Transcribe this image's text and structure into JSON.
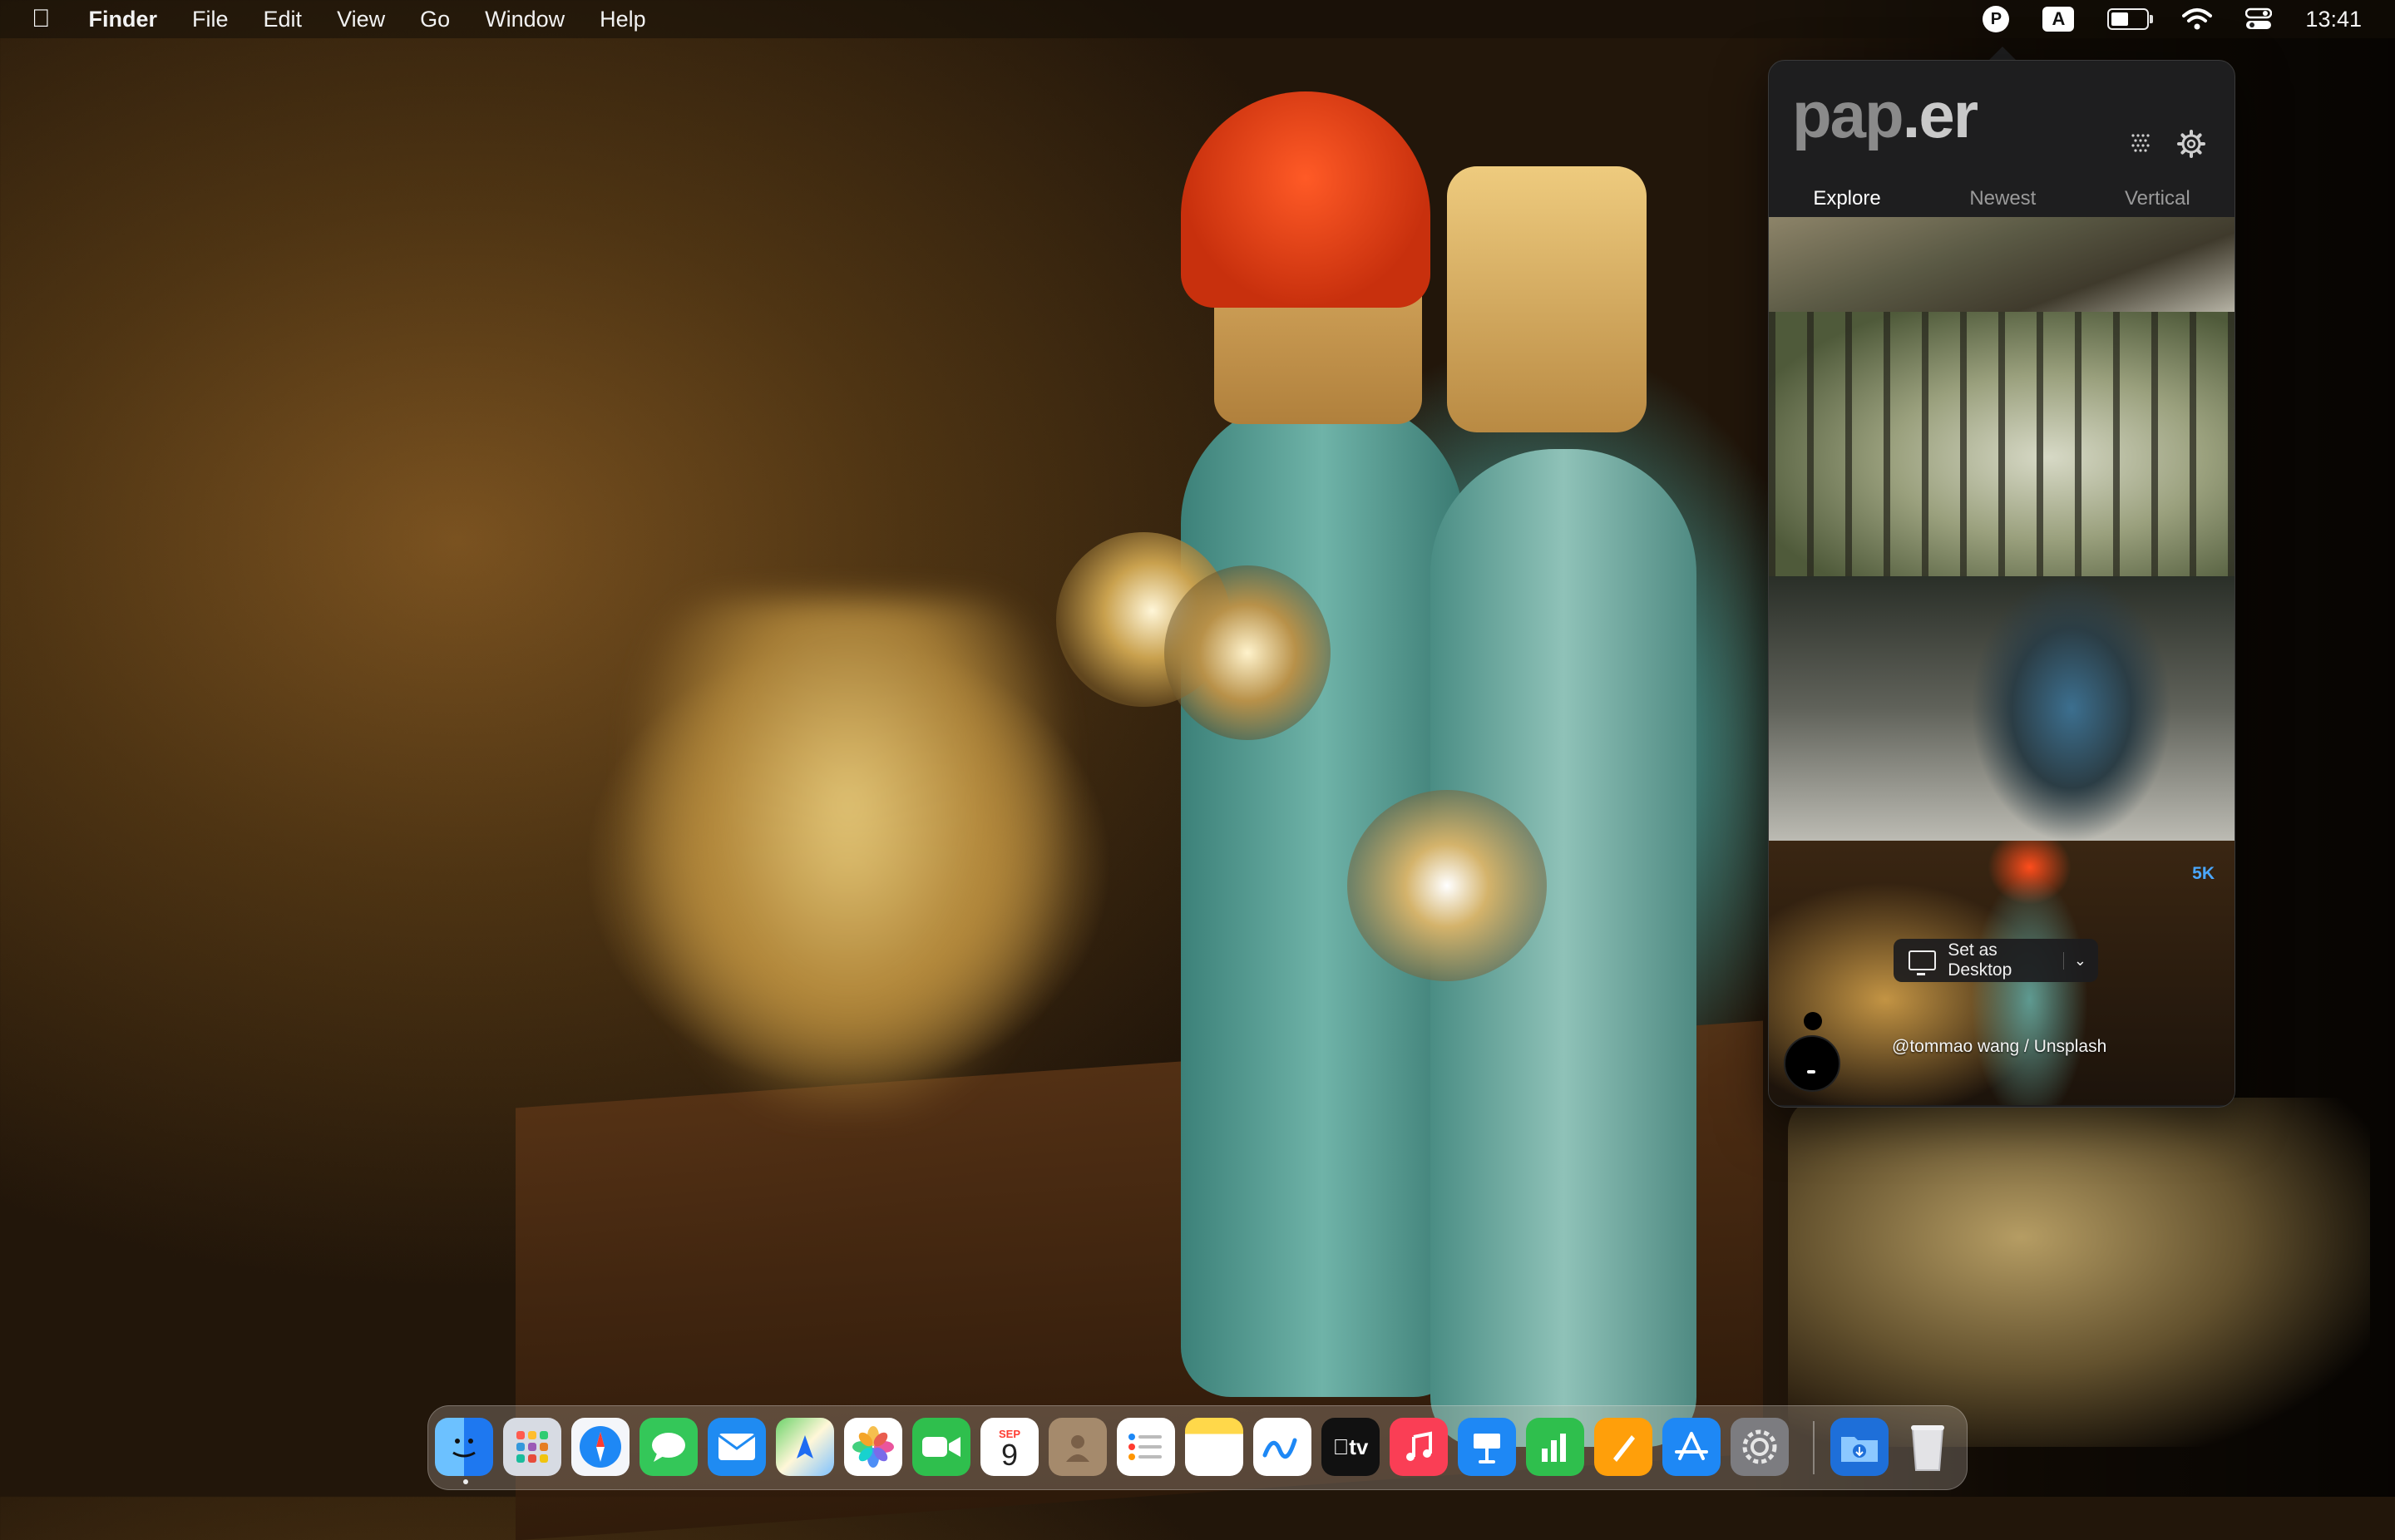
{
  "menubar": {
    "app_name": "Finder",
    "items": [
      "File",
      "Edit",
      "View",
      "Go",
      "Window",
      "Help"
    ],
    "paper_status": "P",
    "input_source": "A",
    "battery_level": 0.55,
    "clock": "13:41"
  },
  "popover": {
    "logo_part1": "pap",
    "logo_part2": ".er",
    "tabs": [
      "Explore",
      "Newest",
      "Vertical"
    ],
    "active_tab": "Explore",
    "featured": {
      "resolution": "5K",
      "set_desktop_label": "Set as Desktop",
      "credit": "@tommao wang / Unsplash"
    }
  },
  "dock": {
    "apps": [
      "Finder",
      "Launchpad",
      "Safari",
      "Messages",
      "Mail",
      "Maps",
      "Photos",
      "FaceTime",
      "Calendar",
      "Contacts",
      "Reminders",
      "Notes",
      "Freeform",
      "TV",
      "Music",
      "Keynote",
      "Numbers",
      "Pages",
      "App Store",
      "System Settings",
      "Downloads",
      "Trash"
    ],
    "calendar_month": "SEP",
    "calendar_day": "9",
    "tv_label": "tv"
  },
  "colors": {
    "accent_blue": "#4aa7ff",
    "popover_bg": "#1e1e1f"
  }
}
